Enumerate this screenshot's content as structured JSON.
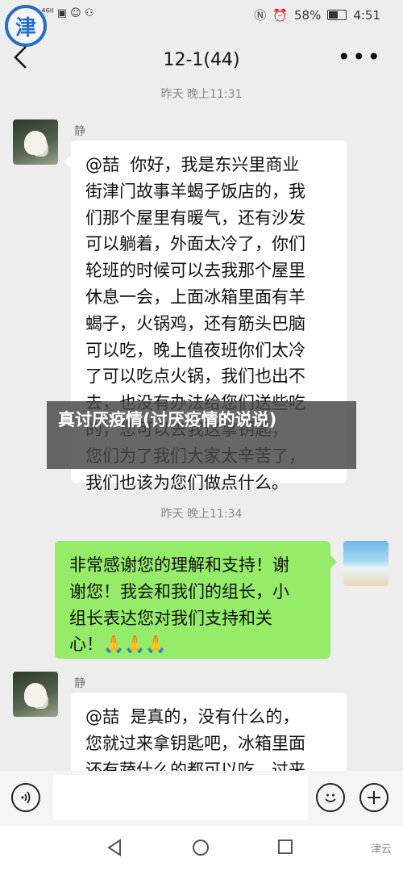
{
  "status": {
    "left_signal": "⁴⁶ᴵᴵ ⁴⁶ᴵᴵ ▣ ☺ ⚇",
    "battery_pct": "58%",
    "time": "4:51"
  },
  "logo": {
    "char": "津"
  },
  "header": {
    "title": "12-1(44)"
  },
  "messages": {
    "ts1": "昨天 晚上11:31",
    "msg1_sender": "静",
    "msg1_text": "@喆  你好，我是东兴里商业\n街津门故事羊蝎子饭店的，我\n们那个屋里有暖气，还有沙发\n可以躺着，外面太冷了，你们\n轮班的时候可以去我那个屋里\n休息一会，上面冰箱里面有羊\n蝎子，火锅鸡，还有筋头巴脑\n可以吃，晚上值夜班你们太冷\n了可以吃点火锅，我们也出不\n去，也没有办法给您们送些吃\n的，您可以去我这拿钥匙，\n您们为了我们大家太辛苦了，\n我们也该为您们做点什么。",
    "ts2": "昨天 晚上11:34",
    "msg2_text": "非常感谢您的理解和支持！谢\n谢您！我会和我们的组长，小\n组长表达您对我们支持和关\n心！🙏🙏🙏",
    "msg3_sender": "静",
    "msg3_text": "@喆  是真的，没有什么的，\n您就过来拿钥匙吧，冰箱里面\n还有蔬什么的都可以吃，过来"
  },
  "overlay": {
    "caption": "真讨厌疫情(讨厌疫情的说说)"
  },
  "footer": {
    "watermark": "津云"
  }
}
